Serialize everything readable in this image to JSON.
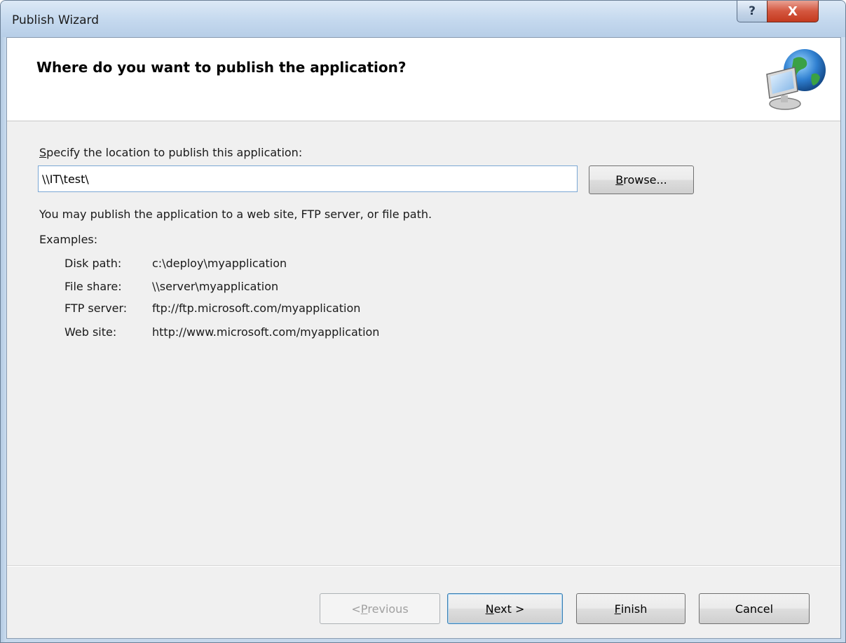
{
  "window": {
    "title": "Publish Wizard",
    "help_glyph": "?",
    "close_glyph": "X"
  },
  "header": {
    "title": "Where do you want to publish the application?",
    "icon": "network-globe-icon"
  },
  "form": {
    "label_first": "S",
    "label_rest": "pecify the location to publish this application:",
    "location_value": "\\\\IT\\test\\",
    "browse_mnemonic": "B",
    "browse_rest": "rowse..."
  },
  "info": {
    "text": "You may publish the application to a web site, FTP server, or file path.",
    "examples_label": "Examples:",
    "examples": [
      {
        "key": "Disk path:",
        "value": "c:\\deploy\\myapplication"
      },
      {
        "key": "File share:",
        "value": "\\\\server\\myapplication"
      },
      {
        "key": "FTP server:",
        "value": "ftp://ftp.microsoft.com/myapplication"
      },
      {
        "key": "Web site:",
        "value": "http://www.microsoft.com/myapplication"
      }
    ]
  },
  "buttons": {
    "previous_prefix": "< ",
    "previous_mnemonic": "P",
    "previous_rest": "revious",
    "next_mnemonic": "N",
    "next_rest": "ext >",
    "finish_mnemonic": "F",
    "finish_rest": "inish",
    "cancel": "Cancel"
  },
  "colors": {
    "accent": "#3c7fb1",
    "close": "#c43a1f"
  }
}
